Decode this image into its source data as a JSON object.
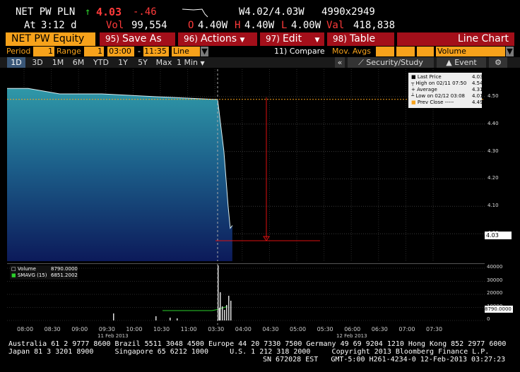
{
  "header": {
    "ticker": "NET PW PLN",
    "arrow": "↑",
    "last": "4.03",
    "change": "-.46",
    "w_range": "W4.02/4.03W",
    "bid_ask": "4990x2949",
    "at_label": "At",
    "at_time": "3:12 d",
    "vol_label": "Vol",
    "vol_value": "99,554",
    "o_label": "O",
    "o_value": "4.40W",
    "h_label": "H",
    "h_value": "4.40W",
    "l_label": "L",
    "l_value": "4.00W",
    "val_label": "Val",
    "val_value": "418,838"
  },
  "toolbar": {
    "security": "NET PW Equity",
    "save_num": "95)",
    "save_label": "Save As",
    "actions_num": "96)",
    "actions_label": "Actions",
    "edit_num": "97)",
    "edit_label": "Edit",
    "table_num": "98)",
    "table_label": "Table",
    "chart_type": "Line Chart"
  },
  "params": {
    "period_label": "Period",
    "period_value": "1",
    "range_label": "Range",
    "range_value": "1",
    "start_time": "03:00",
    "dash": "-",
    "end_time": "11:35",
    "style_value": "Line",
    "compare": "11) Compare",
    "mov_avgs": "Mov. Avgs",
    "volume": "Volume"
  },
  "tabs": [
    "1D",
    "3D",
    "1M",
    "6M",
    "YTD",
    "1Y",
    "5Y",
    "Max",
    "1 Min"
  ],
  "security_study": "Security/Study",
  "event": "Event",
  "legend": {
    "rows": [
      {
        "label": "Last Price",
        "value": "4.03"
      },
      {
        "label": "High on 02/11 07:50",
        "value": "4.54"
      },
      {
        "label": "Average",
        "value": "4.31"
      },
      {
        "label": "Low on 02/12 03:08",
        "value": "4.01"
      },
      {
        "label": "Prev Close -----",
        "value": "4.49"
      }
    ]
  },
  "volume_legend": {
    "vol_label": "Volume",
    "vol_value": "8790.0000",
    "smavg_label": "SMAVG (15)",
    "smavg_value": "6851.2002",
    "last_tag": "8790.0000"
  },
  "price_tag": "4.03",
  "chart_data": {
    "type": "area",
    "ylim": [
      3.9,
      4.6
    ],
    "yticks": [
      "4.50",
      "4.40",
      "4.30",
      "4.20",
      "4.10",
      "4.00"
    ],
    "vol_ticks": [
      "40000",
      "30000",
      "20000",
      "10000",
      "0"
    ],
    "xticks": [
      "08:00",
      "08:30",
      "09:00",
      "09:30",
      "10:00",
      "10:30",
      "11:00",
      "03:30",
      "04:00",
      "04:30",
      "05:00",
      "05:30",
      "06:00",
      "06:30",
      "07:00",
      "07:30"
    ],
    "date_labels": [
      "11 Feb 2013",
      "12 Feb 2013"
    ],
    "series": [
      {
        "name": "Last Price",
        "color": "#2aa7b5",
        "points": [
          [
            0,
            4.53
          ],
          [
            0.1,
            4.53
          ],
          [
            0.25,
            4.51
          ],
          [
            0.45,
            4.51
          ],
          [
            0.7,
            4.5
          ],
          [
            0.98,
            4.49
          ],
          [
            1.0,
            4.49
          ],
          [
            1.03,
            4.3
          ],
          [
            1.05,
            4.1
          ],
          [
            1.06,
            4.02
          ],
          [
            1.07,
            4.03
          ]
        ]
      }
    ],
    "prev_close": 4.49
  },
  "footer": {
    "line1": "Australia 61 2 9777 8600 Brazil 5511 3048 4500 Europe 44 20 7330 7500 Germany 49 69 9204 1210 Hong Kong 852 2977 6000",
    "line2": "Japan 81 3 3201 8900     Singapore 65 6212 1000     U.S. 1 212 318 2000     Copyright 2013 Bloomberg Finance L.P.",
    "line3": "SN 672028 EST   GMT-5:00 H261-4234-0 12-Feb-2013 03:27:23"
  }
}
